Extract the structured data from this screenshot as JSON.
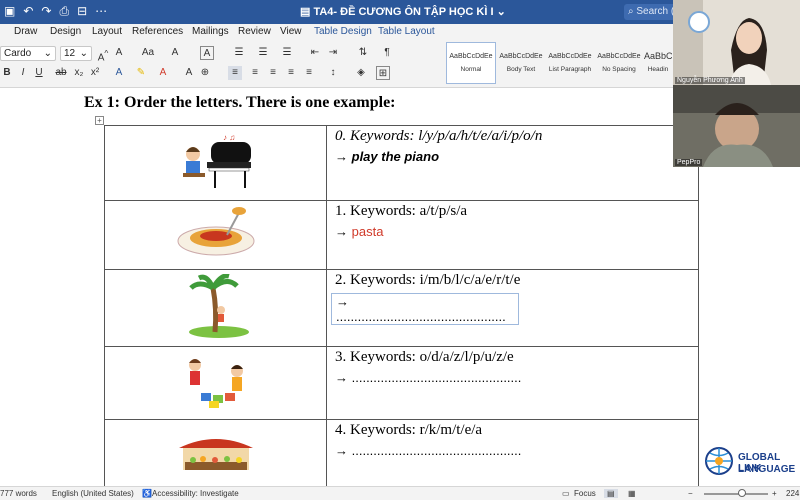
{
  "title_bar": {
    "doc_title": "TA4- ĐỀ CƯƠNG ÔN TẬP HỌC KÌ I",
    "search_placeholder": "Search (C"
  },
  "menu": [
    "Draw",
    "Design",
    "Layout",
    "References",
    "Mailings",
    "Review",
    "View",
    "Table Design",
    "Table Layout"
  ],
  "ribbon": {
    "font_name": "Cardo",
    "font_size": "12",
    "styles": [
      {
        "sample": "AaBbCcDdEe",
        "name": "Normal"
      },
      {
        "sample": "AaBbCcDdEe",
        "name": "Body Text"
      },
      {
        "sample": "AaBbCcDdEe",
        "name": "List Paragraph"
      },
      {
        "sample": "AaBbCcDdEe",
        "name": "No Spacing"
      },
      {
        "sample": "AaBbC",
        "name": "Headin"
      }
    ]
  },
  "document": {
    "heading": "Ex 1: Order the letters. There is one example:",
    "rows": [
      {
        "keywords": "0. Keywords: l/y/p/a/h/t/e/a/i/p/o/n",
        "answer_arrow": "→",
        "answer": "play the piano",
        "picture": "piano-image"
      },
      {
        "keywords": "1. Keywords: a/t/p/s/a",
        "answer_arrow": "→",
        "answer": "pasta",
        "picture": "pasta-image"
      },
      {
        "keywords": "2. Keywords: i/m/b/l/c/a/e/r/t/e",
        "answer_arrow": "→",
        "answer": "...............................................",
        "picture": "climbing-tree-image"
      },
      {
        "keywords": "3. Keywords: o/d/a/z/l/p/u/z/e",
        "answer_arrow": "→",
        "answer": "...............................................",
        "picture": "puzzle-image"
      },
      {
        "keywords": "4. Keywords: r/k/m/t/e/a",
        "answer_arrow": "→",
        "answer": "...............................................",
        "picture": "market-image"
      }
    ]
  },
  "status_bar": {
    "words": "777 words",
    "language": "English (United States)",
    "accessibility": "Accessibility: Investigate",
    "focus": "Focus",
    "zoom": "224"
  },
  "video": {
    "participant_1": "Nguyễn Phương Anh",
    "participant_2": "PepPro"
  },
  "branding": {
    "line1": "GLOBAL LINK",
    "line2": "LANGUAGE"
  },
  "colors": {
    "ribbon_blue": "#2b579a",
    "answer_red": "#d03a2a"
  }
}
